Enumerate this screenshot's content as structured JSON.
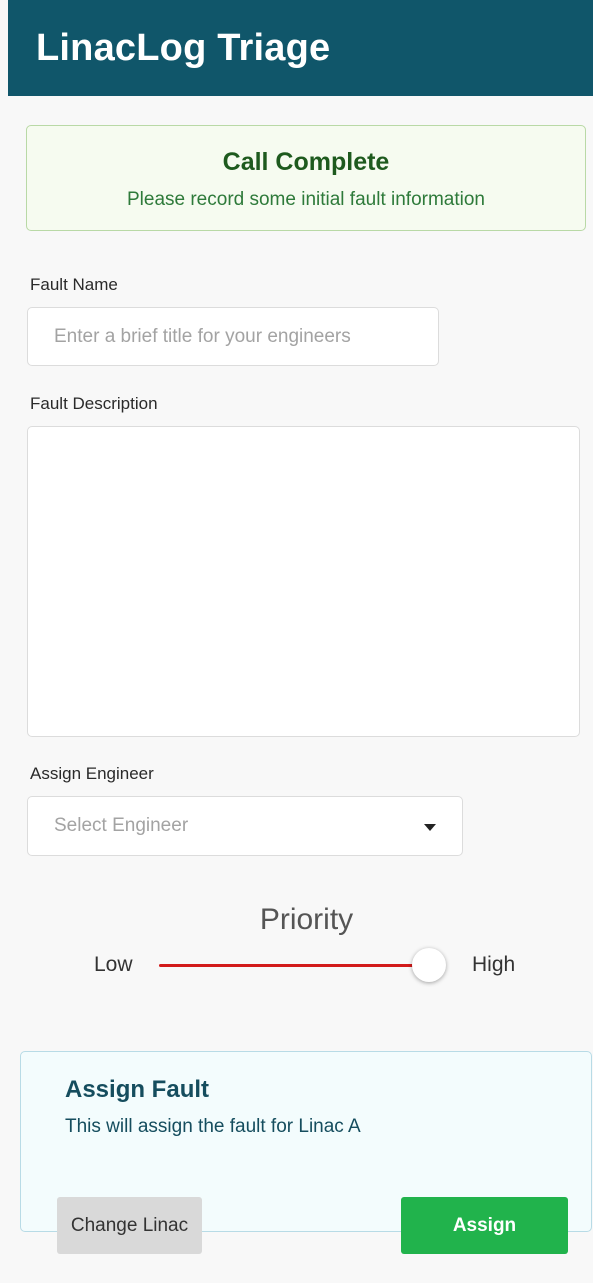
{
  "app": {
    "title": "LinacLog Triage"
  },
  "alert": {
    "title": "Call Complete",
    "message": "Please record some initial fault information"
  },
  "form": {
    "fault_name": {
      "label": "Fault Name",
      "value": "",
      "placeholder": "Enter a brief title for your engineers"
    },
    "fault_description": {
      "label": "Fault Description",
      "value": ""
    },
    "assign_engineer": {
      "label": "Assign Engineer",
      "selected": "Select Engineer"
    },
    "priority": {
      "label": "Priority",
      "low_label": "Low",
      "high_label": "High",
      "value_fraction": 1.0
    }
  },
  "assign_card": {
    "title": "Assign Fault",
    "message": "This will assign the fault for Linac A",
    "change_button": "Change Linac",
    "assign_button": "Assign"
  },
  "colors": {
    "header_bg": "#10566a",
    "success_text": "#1e5a1e",
    "slider_track": "#d21a1a",
    "assign_button": "#21b34c"
  },
  "icons": {
    "select_caret": "caret-down-icon"
  }
}
